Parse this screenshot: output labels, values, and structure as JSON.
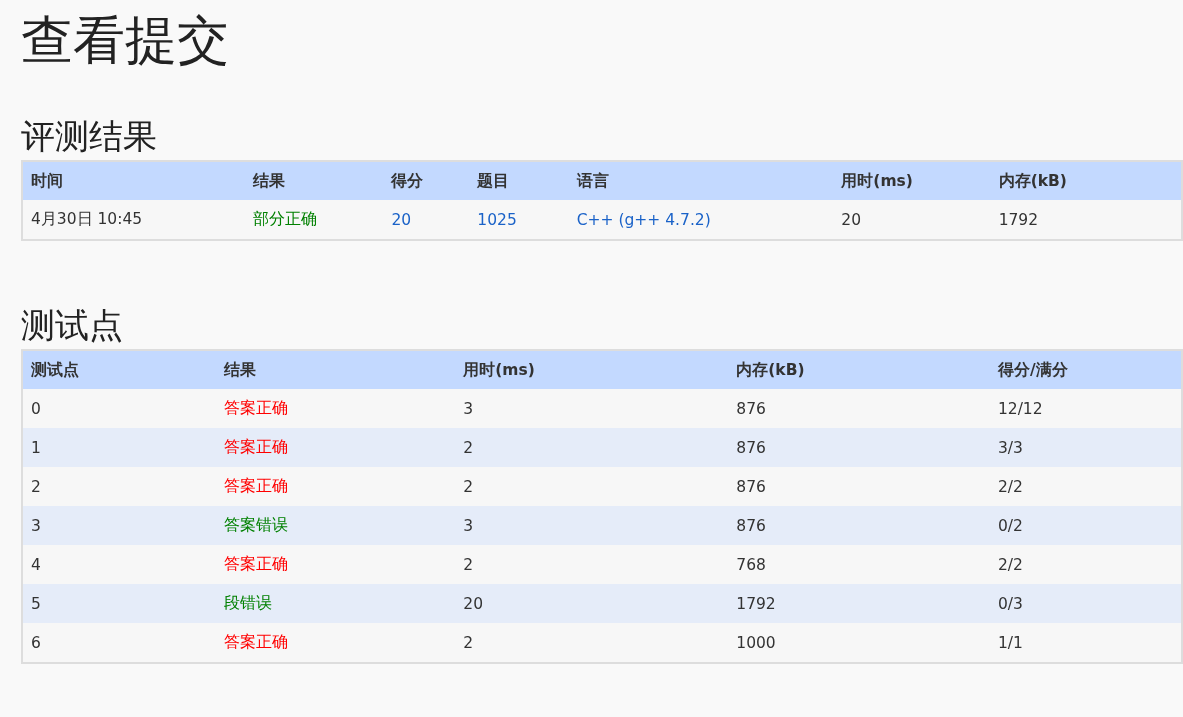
{
  "title": "查看提交",
  "sections": [
    {
      "heading": "评测结果",
      "table": {
        "columns": [
          "时间",
          "结果",
          "得分",
          "题目",
          "语言",
          "用时(ms)",
          "内存(kB)"
        ],
        "rows": [
          [
            {
              "kind": "text",
              "text": "4月30日 10:45"
            },
            {
              "kind": "status",
              "text": "部分正确",
              "color": "#008000"
            },
            {
              "kind": "link",
              "text": "20"
            },
            {
              "kind": "link",
              "text": "1025"
            },
            {
              "kind": "link",
              "text": "C++ (g++ 4.7.2)"
            },
            {
              "kind": "text",
              "text": "20"
            },
            {
              "kind": "text",
              "text": "1792"
            }
          ]
        ]
      }
    },
    {
      "heading": "测试点",
      "table": {
        "columns": [
          "测试点",
          "结果",
          "用时(ms)",
          "内存(kB)",
          "得分/满分"
        ],
        "rows": [
          [
            {
              "kind": "text",
              "text": "0"
            },
            {
              "kind": "status",
              "text": "答案正确",
              "color": "#ff0000"
            },
            {
              "kind": "text",
              "text": "3"
            },
            {
              "kind": "text",
              "text": "876"
            },
            {
              "kind": "text",
              "text": "12/12"
            }
          ],
          [
            {
              "kind": "text",
              "text": "1"
            },
            {
              "kind": "status",
              "text": "答案正确",
              "color": "#ff0000"
            },
            {
              "kind": "text",
              "text": "2"
            },
            {
              "kind": "text",
              "text": "876"
            },
            {
              "kind": "text",
              "text": "3/3"
            }
          ],
          [
            {
              "kind": "text",
              "text": "2"
            },
            {
              "kind": "status",
              "text": "答案正确",
              "color": "#ff0000"
            },
            {
              "kind": "text",
              "text": "2"
            },
            {
              "kind": "text",
              "text": "876"
            },
            {
              "kind": "text",
              "text": "2/2"
            }
          ],
          [
            {
              "kind": "text",
              "text": "3"
            },
            {
              "kind": "status",
              "text": "答案错误",
              "color": "#008000"
            },
            {
              "kind": "text",
              "text": "3"
            },
            {
              "kind": "text",
              "text": "876"
            },
            {
              "kind": "text",
              "text": "0/2"
            }
          ],
          [
            {
              "kind": "text",
              "text": "4"
            },
            {
              "kind": "status",
              "text": "答案正确",
              "color": "#ff0000"
            },
            {
              "kind": "text",
              "text": "2"
            },
            {
              "kind": "text",
              "text": "768"
            },
            {
              "kind": "text",
              "text": "2/2"
            }
          ],
          [
            {
              "kind": "text",
              "text": "5"
            },
            {
              "kind": "status",
              "text": "段错误",
              "color": "#008000"
            },
            {
              "kind": "text",
              "text": "20"
            },
            {
              "kind": "text",
              "text": "1792"
            },
            {
              "kind": "text",
              "text": "0/3"
            }
          ],
          [
            {
              "kind": "text",
              "text": "6"
            },
            {
              "kind": "status",
              "text": "答案正确",
              "color": "#ff0000"
            },
            {
              "kind": "text",
              "text": "2"
            },
            {
              "kind": "text",
              "text": "1000"
            },
            {
              "kind": "text",
              "text": "1/1"
            }
          ]
        ]
      }
    }
  ]
}
